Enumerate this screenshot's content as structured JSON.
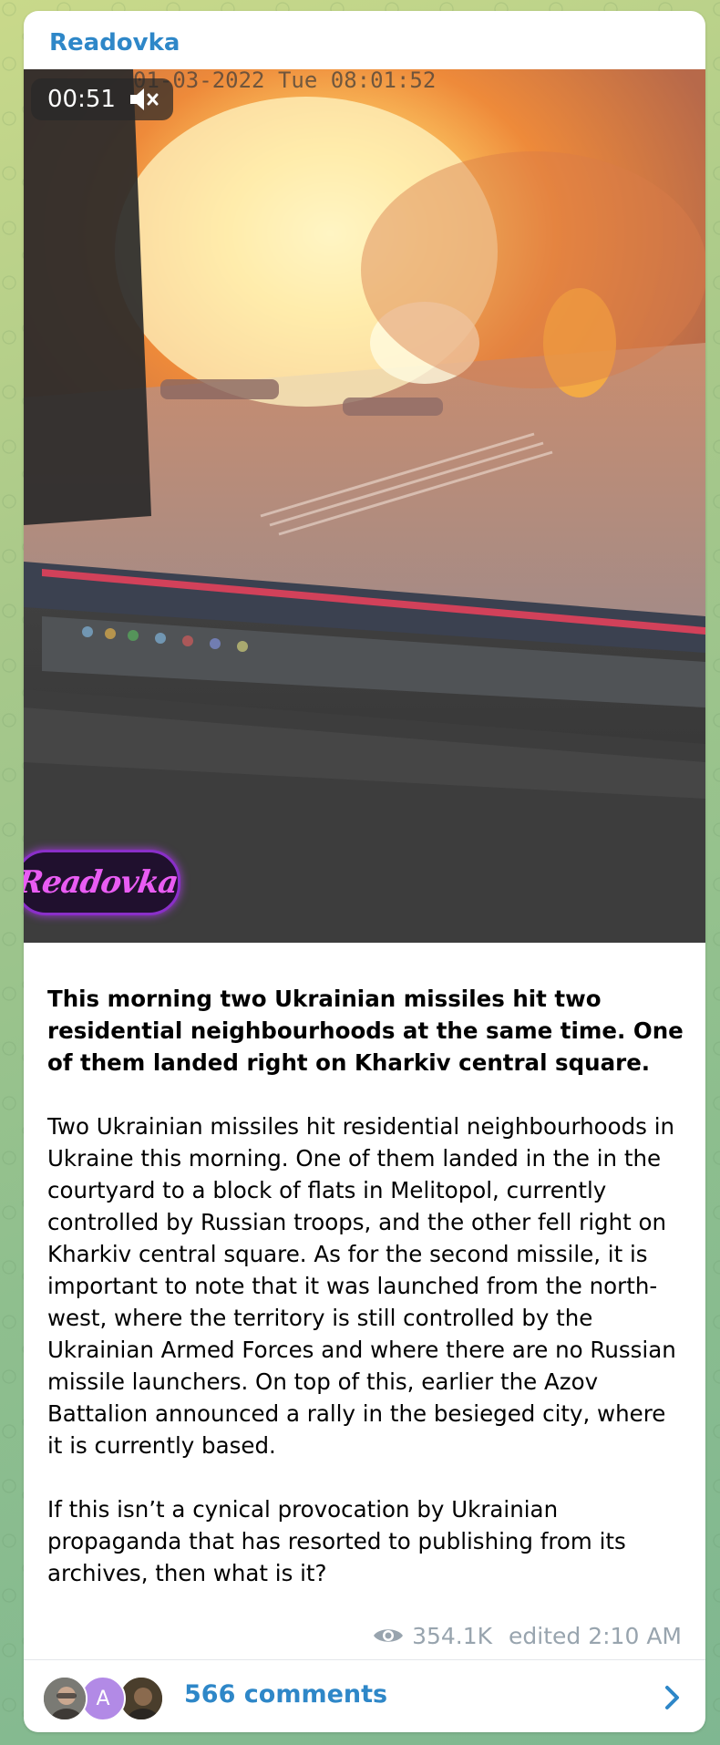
{
  "post": {
    "channel_name": "Readovka",
    "video": {
      "duration": "00:51",
      "muted_icon": "speaker-muted-icon",
      "overlay_timestamp": "01-03-2022 Tue 08:01:52",
      "watermark": "Readovka"
    },
    "headline": "This morning two Ukrainian missiles hit two residential neighbourhoods at the same time. One of them landed right on Kharkiv central square.",
    "body": "Two Ukrainian missiles hit residential neighbourhoods in Ukraine this morning. One of them landed in the in the courtyard to a block of flats in Melitopol, currently controlled by Russian troops, and the other fell right on Kharkiv central square. As for the second missile, it is important to note that it was launched from the north-west, where the territory is still controlled by the Ukrainian Armed Forces and where there are no Russian missile launchers. On top of this, earlier the Azov Battalion announced a rally in the besieged city, where it is currently based.",
    "closing": "If this isn’t a cynical provocation by Ukrainian propaganda that has resorted to publishing from its archives, then what is it?",
    "views": "354.1K",
    "edited": "edited 2:10 AM"
  },
  "comments": {
    "avatar_letter": "A",
    "label": "566 comments"
  },
  "colors": {
    "accent": "#2e87c8",
    "meta_gray": "#98a4ae"
  }
}
